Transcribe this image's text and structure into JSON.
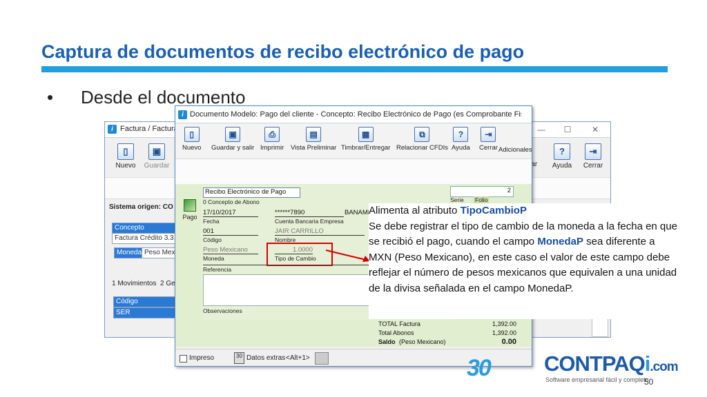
{
  "slide": {
    "title": "Captura de documentos de recibo electrónico de pago",
    "bullet": "•",
    "bullet_text": "Desde el documento",
    "page_number": "50",
    "accent_color": "#1f9ee0",
    "title_color": "#1a5fb0"
  },
  "back_window": {
    "title": "Factura / Factura",
    "controls": [
      "—",
      "☐",
      "✕"
    ],
    "toolbar_left": [
      {
        "label": "Nuevo",
        "icon": "new-doc-icon"
      },
      {
        "label": "Guardar",
        "icon": "save-icon"
      }
    ],
    "toolbar_right": [
      {
        "label": "dar",
        "icon": "partial-icon"
      },
      {
        "label": "Ayuda",
        "icon": "help-icon"
      },
      {
        "label": "Cerrar",
        "icon": "close-door-icon"
      }
    ],
    "sistema_origen": "Sistema origen: CO",
    "concepto_label": "Concepto",
    "concepto_value": "Factura Crédito 3.3",
    "moneda_label": "Moneda",
    "moneda_value": "Peso Mexi",
    "tab_movimientos": "1 Movimientos",
    "tab_ge": "2 Ge",
    "grid_header": "Código",
    "grid_row": "SER"
  },
  "front_window": {
    "title": "Documento Modelo: Pago del cliente - Concepto: Recibo Electrónico de Pago (es Comprobante Fiscal Digital ...",
    "toolbar": [
      {
        "label": "Nuevo",
        "icon": "new-doc-icon"
      },
      {
        "label": "Guardar y salir",
        "icon": "save-icon"
      },
      {
        "label": "Imprimir",
        "icon": "print-icon"
      },
      {
        "label": "Vista Preliminar",
        "icon": "preview-icon"
      },
      {
        "label": "Timbrar/Entregar",
        "icon": "stamp-icon"
      },
      {
        "label": "Relacionar CFDIs",
        "icon": "relate-icon"
      },
      {
        "label": "Ayuda",
        "icon": "help-icon"
      },
      {
        "label": "Cerrar",
        "icon": "close-door-icon"
      }
    ],
    "adicionales": "Adicionales",
    "side_label": "Pago",
    "concepto_value": "Recibo Electrónico de Pago",
    "concepto_label": "0 Concepto de Abono",
    "fecha_value": "17/10/2017",
    "fecha_label": "Fecha",
    "cuenta_value": "******7890",
    "cuenta_label": "Cuenta Bancaria Empresa",
    "banco_value": "BANAME",
    "codigo_value": "001",
    "codigo_label": "Código",
    "nombre_value": "JAIR CARRILLO",
    "nombre_label": "Nombre",
    "moneda_value": "Peso Mexicano",
    "moneda_label": "Moneda",
    "tipo_cambio_value": "1.0000",
    "tipo_cambio_label": "Tipo de Cambio",
    "referencia_label": "Referencia",
    "observaciones_label": "Observaciones",
    "serie_label": "Serie",
    "folio_label": "Folio",
    "folio_value": "2",
    "impreso_label": "Impreso",
    "datos_extras_label": "Datos extras",
    "datos_extras_hint": "<Alt+1>"
  },
  "callout": {
    "line1_prefix": "Alimenta al atributo ",
    "line1_keyword": "TipoCambioP",
    "text_part1": "Se debe registrar el tipo de cambio de la moneda a la fecha en que se recibió el pago, cuando el campo ",
    "keyword2": "MonedaP",
    "text_part2": " sea diferente a MXN (Peso Mexicano), en este caso el valor de este campo debe reflejar el número de pesos mexicanos que equivalen a una unidad de la divisa señalada en el campo MonedaP."
  },
  "totals": {
    "total_factura_label": "TOTAL Factura",
    "total_factura_value": "1,392.00",
    "total_abonos_label": "Total Abonos",
    "total_abonos_value": "1,392.00",
    "saldo_label": "Saldo",
    "saldo_sub": "(Peso Mexicano)",
    "saldo_value": "0.00"
  },
  "branding": {
    "anniversary": "30",
    "logo_main": "CONTPAQ",
    "logo_i": "i",
    "logo_dotcom": ".com",
    "tagline": "Software empresarial fácil y completo"
  }
}
